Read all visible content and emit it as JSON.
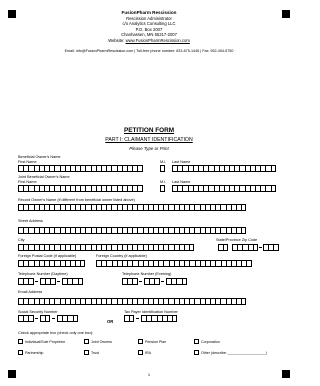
{
  "header": {
    "name": "FusionPharm Rescission",
    "line1": "Rescission Administrator",
    "line2": "c/o Analytics Consulting LLC",
    "line3": "P.O. Box 2007",
    "line4": "Chanhassen, MN 55317-2007",
    "website_label": "Website: ",
    "website": "www.FusionPharmRescission.com",
    "contact": "Email: info@FusionPharmRescission.com  |  Toll-free phone number: 833-675-1445  |  Fax: 952-404-5750"
  },
  "form": {
    "title": "PETITION FORM",
    "part": "PART I: CLAIMANT IDENTIFICATION",
    "instructions": "Please Type or Print"
  },
  "fields": {
    "beneficial_owner": "Beneficial Owner's Name",
    "first_name": "First Name",
    "mi": "M.I.",
    "last_name": "Last Name",
    "joint_owner": "Joint Beneficial Owner's Name",
    "record_owner": "Record Owner's Name (if different from beneficial owner listed above)",
    "street": "Street Address",
    "city": "City",
    "state_zip": "State/Province  Zip Code",
    "foreign_postal": "Foreign Postal Code (if applicable)",
    "foreign_country": "Foreign Country (if applicable)",
    "tel_day": "Telephone Number (Daytime)",
    "tel_eve": "Telephone Number (Evening)",
    "email": "Email Address",
    "ssn": "Social Security Number",
    "tin": "Tax Payer Identification Number",
    "or": "OR",
    "entity_prompt": "Check appropriate box (check only one box):"
  },
  "checkboxes": [
    "Individual/Sole Proprietor",
    "Joint Owners",
    "Pension Plan",
    "Corporation",
    "Partnership",
    "Trust",
    "IRA",
    "Other (describe: ___________________)"
  ],
  "page_number": "1"
}
